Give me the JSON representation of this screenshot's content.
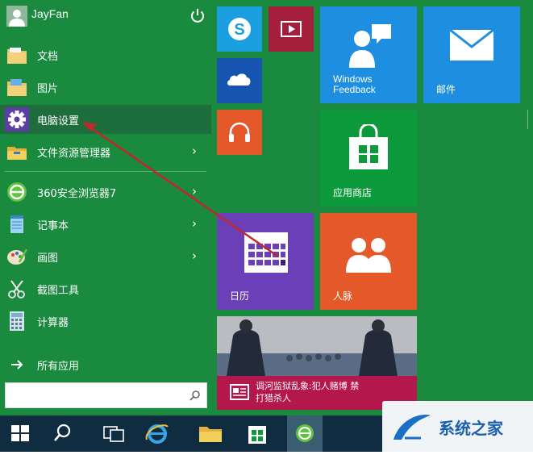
{
  "user": {
    "name": "JayFan"
  },
  "menu": [
    {
      "label": "文档",
      "icon": "documents-folder-icon",
      "chevron": false
    },
    {
      "label": "图片",
      "icon": "pictures-folder-icon",
      "chevron": false
    },
    {
      "label": "电脑设置",
      "icon": "gear-icon",
      "chevron": false,
      "selected": true
    },
    {
      "label": "文件资源管理器",
      "icon": "file-explorer-icon",
      "chevron": true
    },
    {
      "label": "360安全浏览器7",
      "icon": "360-browser-icon",
      "chevron": true
    },
    {
      "label": "记事本",
      "icon": "notepad-icon",
      "chevron": true
    },
    {
      "label": "画图",
      "icon": "paint-icon",
      "chevron": true
    },
    {
      "label": "截图工具",
      "icon": "snipping-tool-icon",
      "chevron": false
    },
    {
      "label": "计算器",
      "icon": "calculator-icon",
      "chevron": false
    }
  ],
  "all_apps": {
    "label": "所有应用"
  },
  "tiles": {
    "windows_feedback": {
      "line1": "Windows",
      "line2": "Feedback"
    },
    "mail": {
      "label": "邮件"
    },
    "store": {
      "label": "应用商店"
    },
    "calendar": {
      "label": "日历"
    },
    "people": {
      "label": "人脉"
    },
    "news": {
      "line1": "调河监狱乱象:犯人赌博 禁",
      "line2": "打猎杀人"
    }
  },
  "watermark": {
    "text": "系统之家"
  },
  "colors": {
    "start_bg": "#1a8a3e",
    "tile_blue": "#1e8fe0",
    "tile_green": "#0d9a3c",
    "tile_purple": "#6b3fb8",
    "tile_orange": "#e4582a",
    "tile_red_crimson": "#b4174b",
    "taskbar": "#0f2c40"
  }
}
